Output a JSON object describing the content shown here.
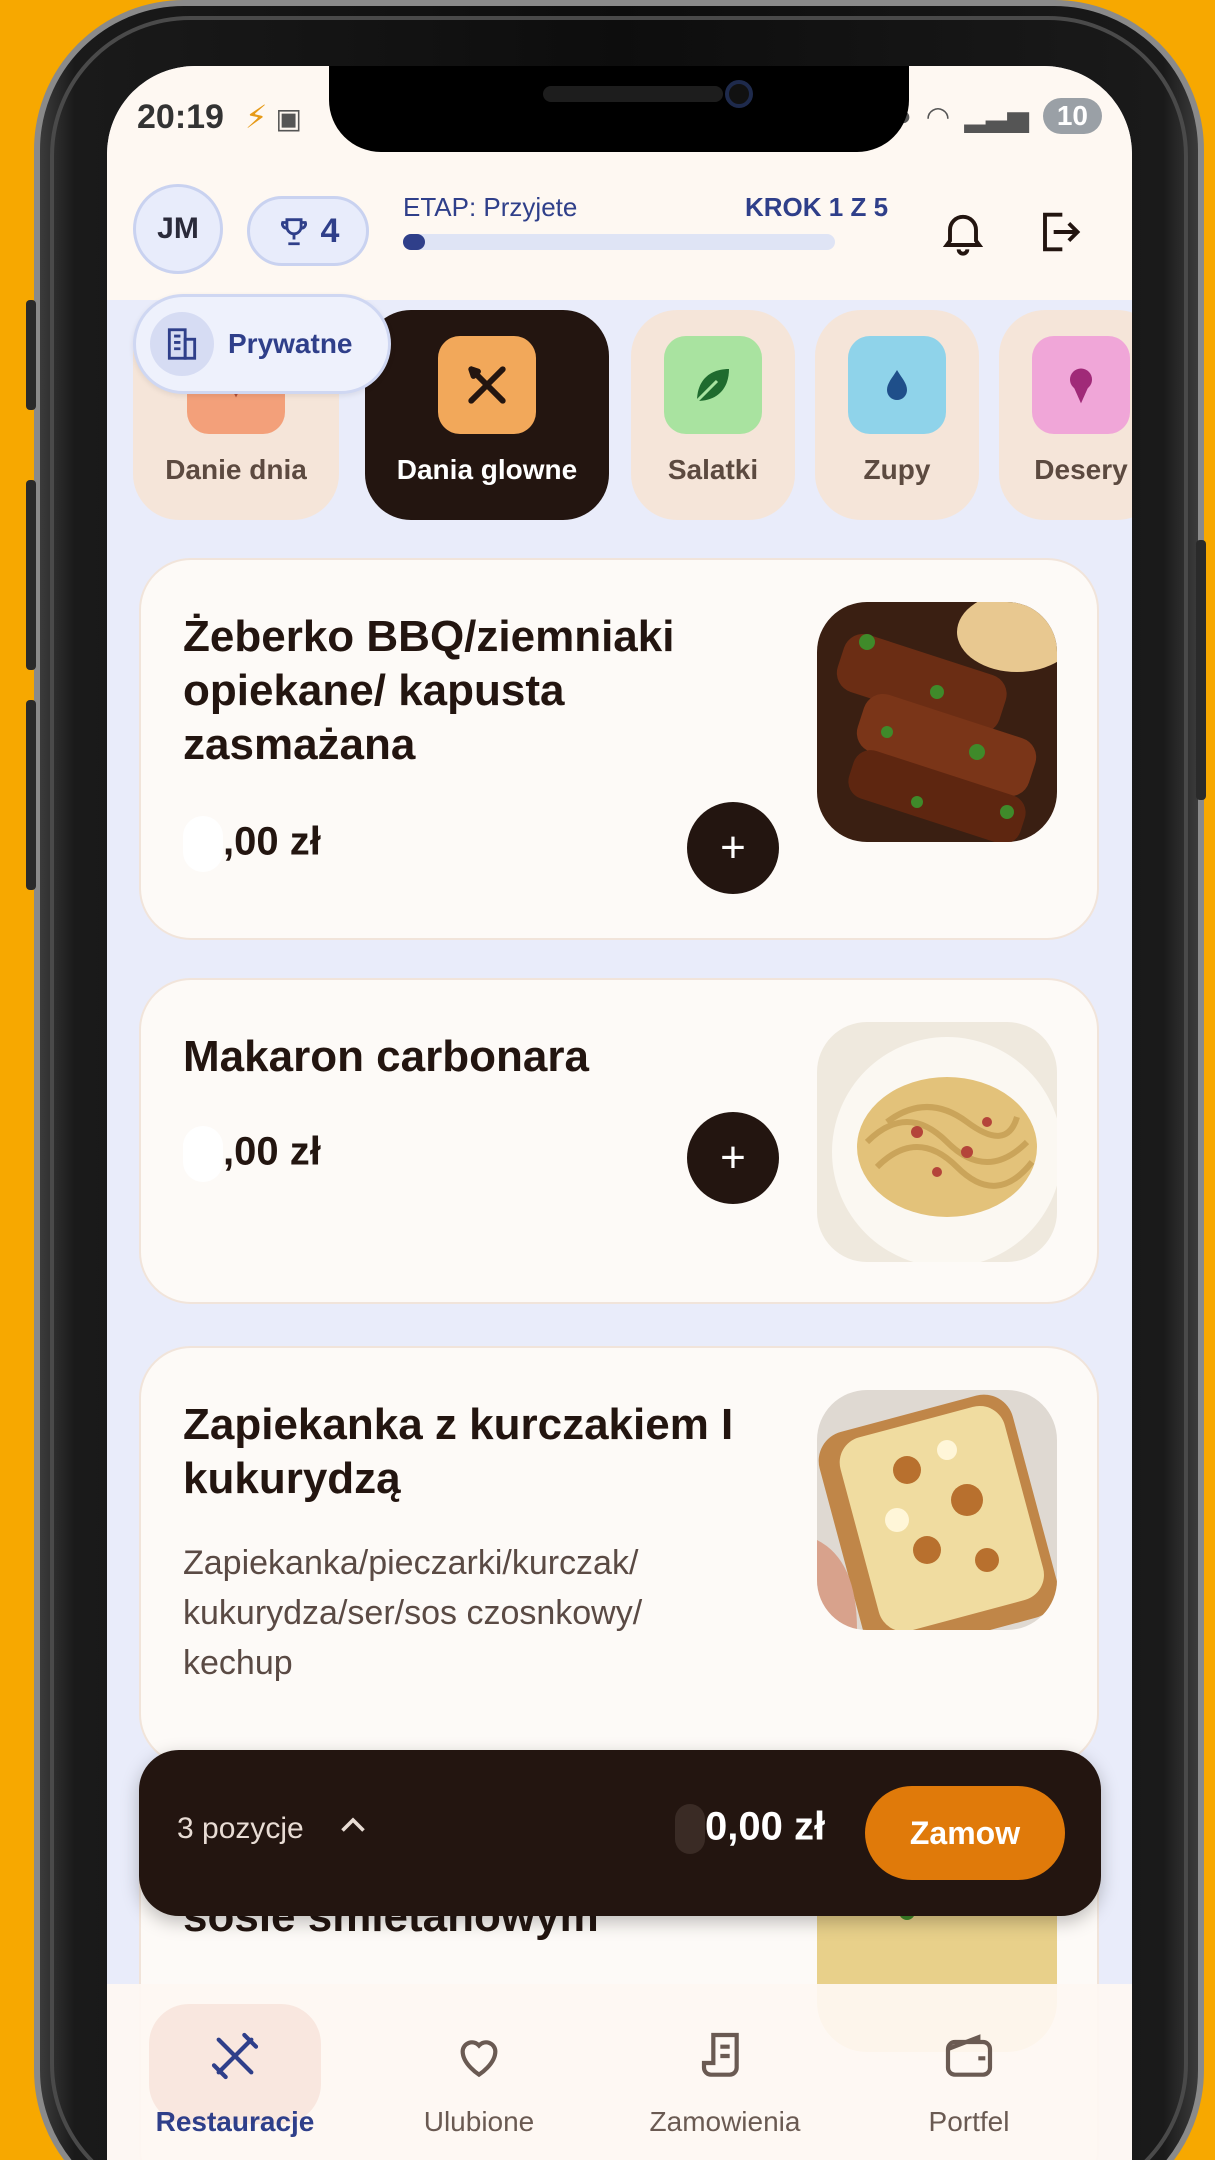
{
  "status_bar": {
    "time": "20:19",
    "battery": "10"
  },
  "header": {
    "avatar_initials": "JM",
    "trophy_count": "4",
    "stage_label": "ETAP: Przyjete",
    "step_label": "KROK 1 Z 5",
    "progress_fraction": 0.05
  },
  "context_chip": {
    "label": "Prywatne"
  },
  "categories": [
    {
      "label": "Danie dnia",
      "icon": "plate-icon",
      "color": "#f3a07a",
      "active": false
    },
    {
      "label": "Dania glowne",
      "icon": "fork-knife-icon",
      "color": "#f2a85a",
      "active": true
    },
    {
      "label": "Salatki",
      "icon": "leaf-icon",
      "color": "#a9e3a0",
      "active": false
    },
    {
      "label": "Zupy",
      "icon": "drop-icon",
      "color": "#8fd3ea",
      "active": false
    },
    {
      "label": "Desery",
      "icon": "ice-cream-icon",
      "color": "#f0a6d8",
      "active": false
    }
  ],
  "dishes": [
    {
      "title": "Żeberko BBQ/ziemniaki opiekane/ kapusta zasmażana",
      "description": "",
      "price": ",00 zł"
    },
    {
      "title": "Makaron carbonara",
      "description": "",
      "price": ",00 zł"
    },
    {
      "title": "Zapiekanka z kurczakiem I kukurydzą",
      "description": "Zapiekanka/pieczarki/kurczak/ kukurydza/ser/sos czosnkowy/ kechup",
      "price": ""
    },
    {
      "title": "Makaron z warzywami w sosie śmietanowym",
      "description": "",
      "price": ""
    }
  ],
  "cart": {
    "count_label": "3 pozycje",
    "total": "0,00 zł",
    "order_label": "Zamow"
  },
  "nav": [
    {
      "label": "Restauracje",
      "icon": "fork-knife-icon",
      "active": true
    },
    {
      "label": "Ulubione",
      "icon": "heart-icon",
      "active": false
    },
    {
      "label": "Zamowienia",
      "icon": "receipt-icon",
      "active": false
    },
    {
      "label": "Portfel",
      "icon": "wallet-icon",
      "active": false
    }
  ],
  "colors": {
    "background": "#f7a800",
    "accent_dark": "#231510",
    "brand_blue": "#2f3f8a",
    "order_orange": "#e07a0a"
  }
}
